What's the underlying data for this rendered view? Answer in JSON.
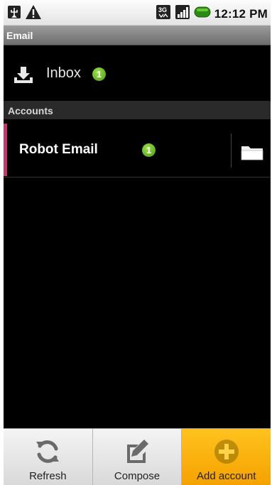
{
  "status_bar": {
    "time": "12:12 PM",
    "icons": [
      "usb-icon",
      "warning-icon",
      "3g-icon",
      "signal-icon",
      "battery-icon"
    ],
    "network": "3G"
  },
  "title_bar": {
    "title": "Email"
  },
  "inbox": {
    "label": "Inbox",
    "unread": "1"
  },
  "accounts_section": {
    "header": "Accounts"
  },
  "accounts": [
    {
      "name": "Robot Email",
      "unread": "1",
      "accent_color": "#c03a6b"
    }
  ],
  "menu": {
    "items": [
      {
        "label": "Refresh",
        "icon": "refresh-icon"
      },
      {
        "label": "Compose",
        "icon": "compose-icon"
      },
      {
        "label": "Add account",
        "icon": "add-icon",
        "highlighted": true
      }
    ],
    "highlight_color": "#f5a200"
  }
}
